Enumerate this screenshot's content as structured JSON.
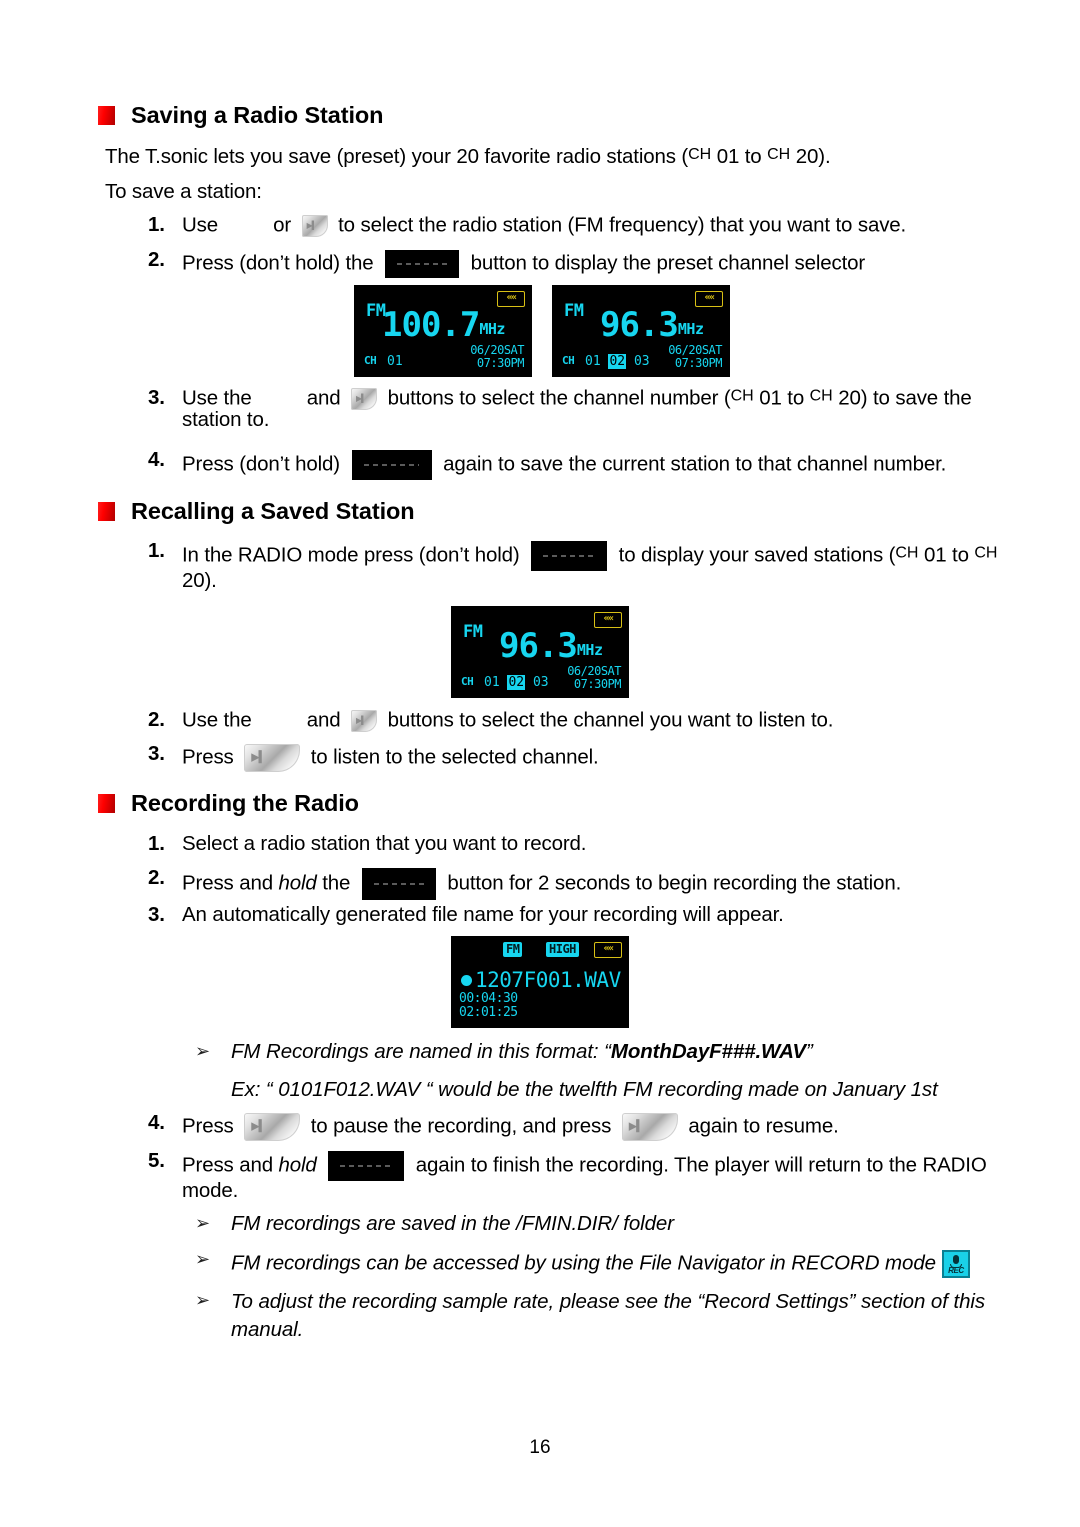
{
  "page": {
    "number": "16"
  },
  "sections": [
    {
      "id": "saving",
      "title": "Saving a Radio Station",
      "intro_1_a": "The T.sonic lets you save (preset) your 20 favorite radio stations (",
      "intro_1_sup1": "CH",
      "intro_1_b": " 01 to ",
      "intro_1_sup2": "CH",
      "intro_1_c": " 20).",
      "intro_2": "To save a station:",
      "steps": [
        {
          "num": "1.",
          "a": "Use",
          "b": "or",
          "c": "to select the radio station (FM frequency) that you want to save."
        },
        {
          "num": "2.",
          "a": "Press (don’t hold) the",
          "b": "button to display the preset channel selector"
        },
        {
          "num": "3.",
          "a": "Use the",
          "b": "and",
          "c": "buttons to select the channel number (",
          "sup1": "CH",
          "d": " 01 to ",
          "sup2": "CH",
          "e": " 20) to save the station to."
        },
        {
          "num": "4.",
          "a": "Press (don’t hold)",
          "b": "again to save the current station to that channel number."
        }
      ]
    },
    {
      "id": "recalling",
      "title": "Recalling a Saved Station",
      "steps": [
        {
          "num": "1.",
          "a": "In the RADIO mode press (don’t hold)",
          "b": "to display your saved stations (",
          "sup1": "CH",
          "c": " 01 to ",
          "sup2": "CH",
          "d": " 20)."
        },
        {
          "num": "2.",
          "a": "Use the",
          "b": "and",
          "c": "buttons to select the channel you want to listen to."
        },
        {
          "num": "3.",
          "a": "Press",
          "b": "to listen to the selected channel."
        }
      ]
    },
    {
      "id": "recording",
      "title": "Recording the Radio",
      "steps": [
        {
          "num": "1.",
          "a": "Select a radio station that you want to record."
        },
        {
          "num": "2.",
          "a": "Press and ",
          "ital": "hold",
          "b": " the",
          "c": "button for 2 seconds to begin recording the station."
        },
        {
          "num": "3.",
          "a": "An automatically generated file name for your recording will appear."
        },
        {
          "num": "4.",
          "a": "Press",
          "b": "to pause the recording, and press",
          "c": "again to resume."
        },
        {
          "num": "5.",
          "a": "Press and ",
          "ital": "hold",
          "b": "",
          "c": "again to finish the recording. The player will return to the RADIO mode."
        }
      ]
    }
  ],
  "notes": {
    "naming_format_a": "FM Recordings are named in this format: “",
    "naming_format_bold": "MonthDayF###.WAV",
    "naming_format_b": "”",
    "example": "Ex: “ 0101F012.WAV “ would be the twelfth FM recording made on January 1st",
    "saved_folder": "FM recordings are saved in the /FMIN.DIR/ folder",
    "file_navigator": "FM recordings can be accessed by using the File Navigator in RECORD mode",
    "sample_rate": "To adjust the recording sample rate, please see the “Record Settings” section of this manual.",
    "arrow_glyph": "➢"
  },
  "lcd_screens": {
    "preset_before": {
      "band": "FM",
      "frequency": "100.7",
      "unit": "MHz",
      "ch_label": "CH",
      "channels_plain": "01",
      "date": "06/20",
      "weekday": "SAT",
      "time": "07:30",
      "ampm": "PM",
      "signal_icon": "««"
    },
    "preset_selector": {
      "band": "FM",
      "frequency": "96.3",
      "unit": "MHz",
      "ch_label": "CH",
      "ch_1": "01",
      "ch_2_selected": "02",
      "ch_3": "03",
      "date": "06/20",
      "weekday": "SAT",
      "time": "07:30",
      "ampm": "PM",
      "signal_icon": "««"
    },
    "recall": {
      "band": "FM",
      "frequency": "96.3",
      "unit": "MHz",
      "ch_label": "CH",
      "ch_1": "01",
      "ch_2_selected": "02",
      "ch_3": "03",
      "date": "06/20",
      "weekday": "SAT",
      "time": "07:30",
      "ampm": "PM",
      "signal_icon": "««"
    },
    "recording": {
      "tag_fm": "FM",
      "tag_quality": "HIGH",
      "signal_icon": "««",
      "filename": "1207F001.WAV",
      "elapsed": "00:04:30",
      "remaining": "02:01:25"
    }
  },
  "icons": {
    "play_pause_glyph": "▶▍",
    "rec_label": "REC",
    "bullet_color": "#ff0000",
    "lcd_color": "#17d6f0",
    "lcd_bg": "#000000",
    "lcd_accent_yellow": "#d8c015"
  }
}
